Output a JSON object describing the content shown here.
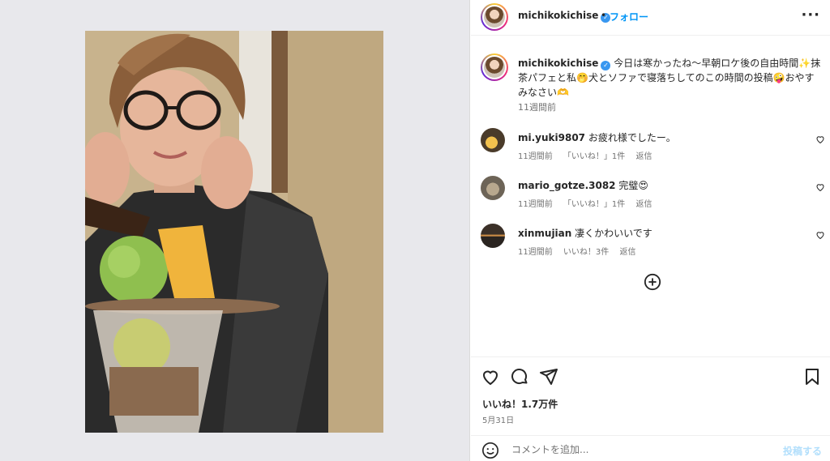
{
  "post": {
    "username": "michikokichise",
    "follow_label": "フォロー",
    "separator": "•",
    "more_icon": "more-horizontal-icon",
    "caption_text": "今日は寒かったね〜早朝ロケ後の自由時間✨抹茶パフェと私🤭犬とソファで寝落ちしてのこの時間の投稿🤪おやすみなさい🫶",
    "caption_time": "11週間前",
    "likes": "いいね！1.7万件",
    "date": "5月31日"
  },
  "comments": [
    {
      "username": "mi.yuki9807",
      "text": "お疲れ様でしたー。",
      "time": "11週間前",
      "likes": "「いいね！」1件",
      "reply": "返信"
    },
    {
      "username": "mario_gotze.3082",
      "text": "完璧😍",
      "time": "11週間前",
      "likes": "「いいね！」1件",
      "reply": "返信"
    },
    {
      "username": "xinmujian",
      "text": "凄くかわいいです",
      "time": "11週間前",
      "likes": "いいね！3件",
      "reply": "返信"
    }
  ],
  "comment_box": {
    "placeholder": "コメントを追加...",
    "post_label": "投稿する"
  },
  "colors": {
    "accent": "#0095f6",
    "verified": "#3897f0",
    "muted": "#737373"
  },
  "icons": [
    "verified-badge-icon",
    "heart-icon",
    "comment-icon",
    "share-icon",
    "bookmark-icon",
    "emoji-icon",
    "add-circle-icon"
  ]
}
